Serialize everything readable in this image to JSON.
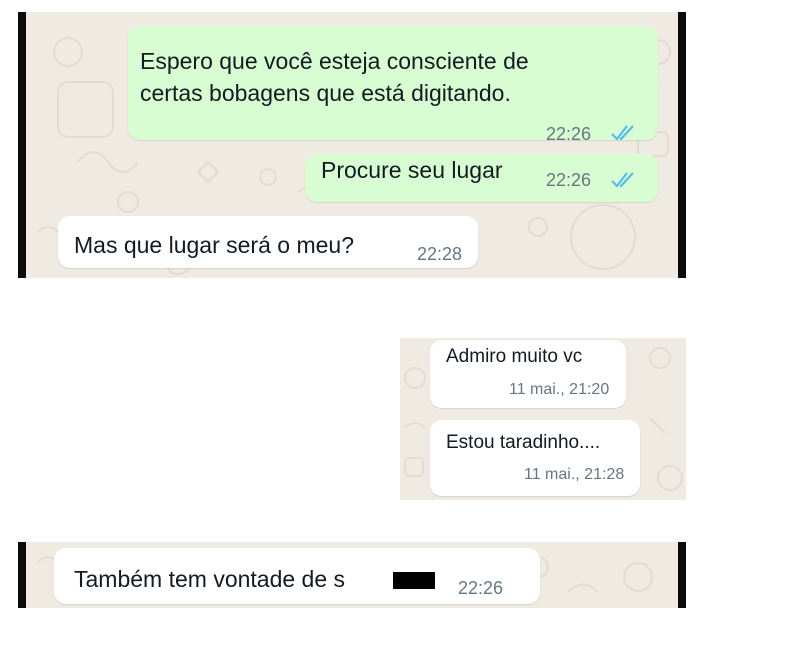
{
  "colors": {
    "background": "#efeae2",
    "outgoing_bubble": "#d9fdd3",
    "incoming_bubble": "#ffffff",
    "read_ticks": "#53bdeb",
    "time_text": "#667781",
    "message_text": "#111b21"
  },
  "screenshot1": {
    "messages": [
      {
        "direction": "outgoing",
        "line1": "Espero que você esteja consciente de",
        "line2": "certas bobagens que está digitando.",
        "time": "22:26",
        "status_icon": "double-check-read-icon"
      },
      {
        "direction": "outgoing",
        "text": "Procure seu lugar",
        "time": "22:26",
        "status_icon": "double-check-read-icon"
      },
      {
        "direction": "incoming",
        "text": "Mas que lugar será o meu?",
        "time": "22:28"
      }
    ]
  },
  "screenshot2": {
    "messages": [
      {
        "direction": "outgoing",
        "text": "Admiro muito vc",
        "time": "11 mai., 21:20"
      },
      {
        "direction": "outgoing",
        "text": "Estou taradinho....",
        "time": "11 mai., 21:28"
      }
    ]
  },
  "screenshot3": {
    "messages": [
      {
        "direction": "incoming",
        "text": "Também tem vontade de s",
        "time": "22:26",
        "redacted": true
      }
    ]
  }
}
